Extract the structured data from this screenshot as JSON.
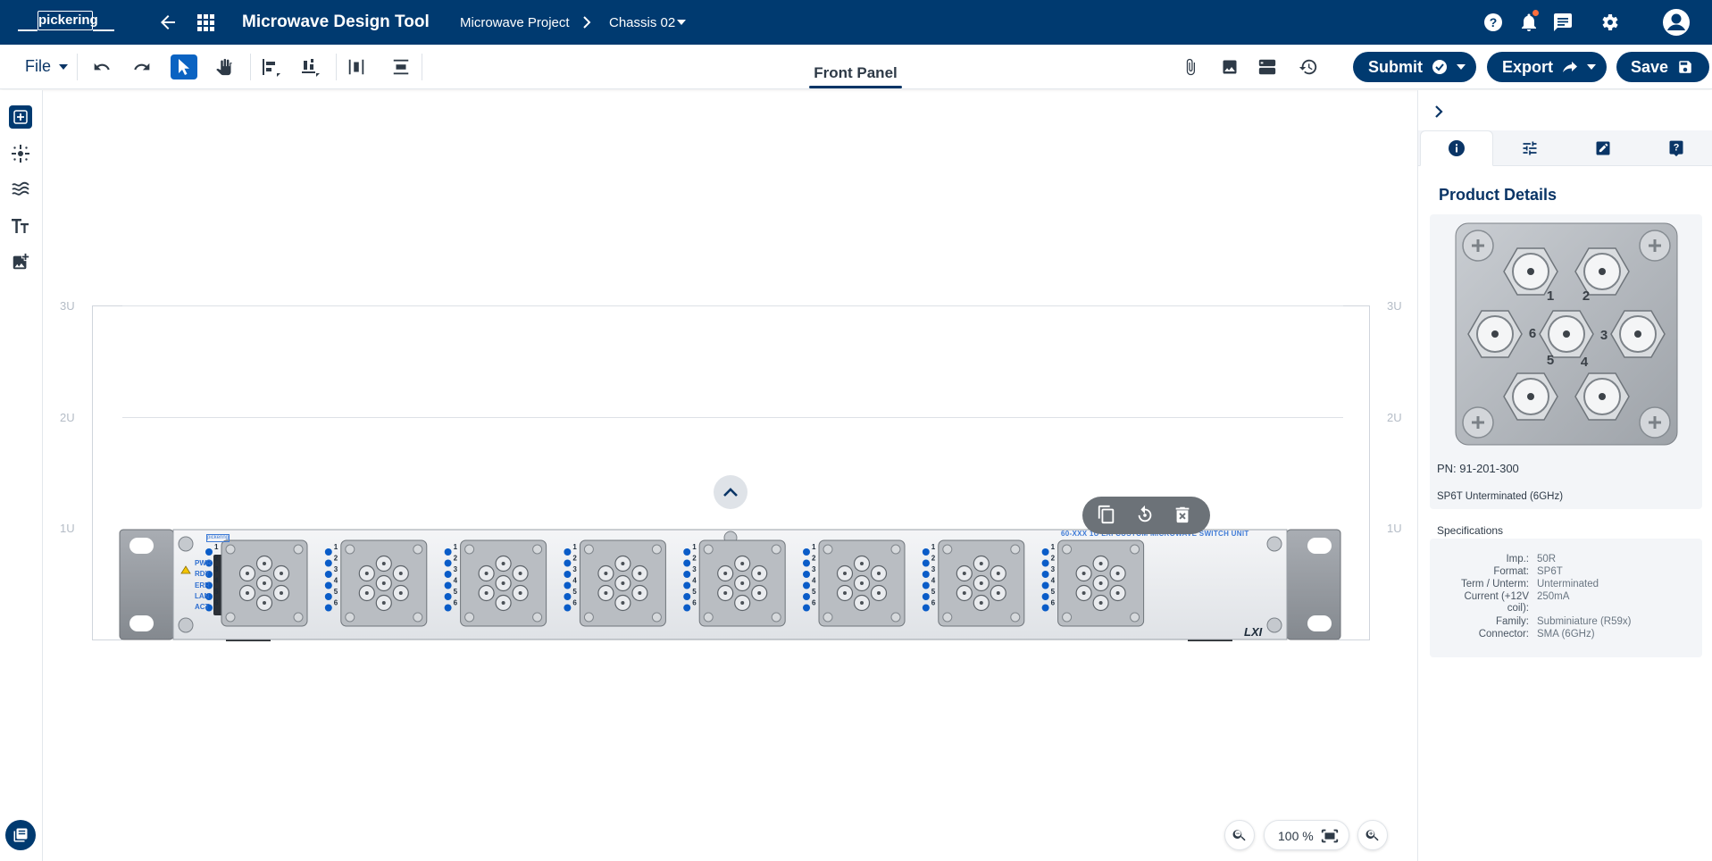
{
  "app": {
    "logo_text": "pickering",
    "title": "Microwave Design Tool",
    "breadcrumb": [
      "Microwave Project",
      "Chassis 02"
    ],
    "colors": {
      "brand": "#003a70",
      "accent": "#0a63c2",
      "notification": "#ff6d3b"
    }
  },
  "header_icons": [
    "back-arrow-icon",
    "apps-grid-icon",
    "help-icon",
    "bell-icon",
    "chat-icon",
    "gear-icon",
    "account-icon"
  ],
  "toolbar": {
    "file_label": "File",
    "tools": [
      "undo-icon",
      "redo-icon",
      "select-pointer-icon",
      "pan-hand-icon",
      "align-left-icon",
      "align-bottom-icon",
      "distribute-horizontal-icon",
      "distribute-vertical-icon"
    ],
    "active_tool": "select-pointer-icon",
    "center_tab": "Front Panel",
    "right_icons": [
      "attachment-icon",
      "image-icon",
      "layout-icon",
      "history-icon"
    ],
    "submit_label": "Submit",
    "export_label": "Export",
    "save_label": "Save"
  },
  "left_rail": [
    "add-icon",
    "component-icon",
    "waves-icon",
    "text-icon",
    "add-image-icon"
  ],
  "canvas": {
    "rack_units_left": [
      "3U",
      "2U",
      "1U"
    ],
    "rack_units_right": [
      "3U",
      "2U",
      "1U"
    ],
    "chassis_label": "60-XXX 1U LXI CUSTOM MICROWAVE SWITCH UNIT",
    "chassis_logo": "LXI",
    "mini_logo": "pickering",
    "status_leds": [
      "PWR",
      "RDY",
      "ERR",
      "LAN",
      "ACT"
    ],
    "channel_numbers": [
      "1",
      "2",
      "3",
      "4",
      "5",
      "6"
    ],
    "module_count": 8,
    "selection_tools": [
      "copy-icon",
      "rotate-icon",
      "delete-icon"
    ]
  },
  "zoom": {
    "level": "100 %"
  },
  "right_panel": {
    "tabs": [
      "info-icon",
      "tune-icon",
      "edit-icon",
      "help-icon"
    ],
    "active_tab": "info-icon",
    "title": "Product Details",
    "part_number": "PN: 91-201-300",
    "description": "SP6T Unterminated (6GHz)",
    "connector_numbers": [
      "1",
      "2",
      "3",
      "4",
      "5",
      "6"
    ],
    "specs_title": "Specifications",
    "specs": [
      {
        "key": "Imp.:",
        "value": "50R"
      },
      {
        "key": "Format:",
        "value": "SP6T"
      },
      {
        "key": "Term / Unterm:",
        "value": "Unterminated"
      },
      {
        "key": "Current (+12V",
        "value": "250mA"
      },
      {
        "key": "coil):",
        "value": ""
      },
      {
        "key": "Family:",
        "value": "Subminiature (R59x)"
      },
      {
        "key": "Connector:",
        "value": "SMA (6GHz)"
      }
    ]
  }
}
